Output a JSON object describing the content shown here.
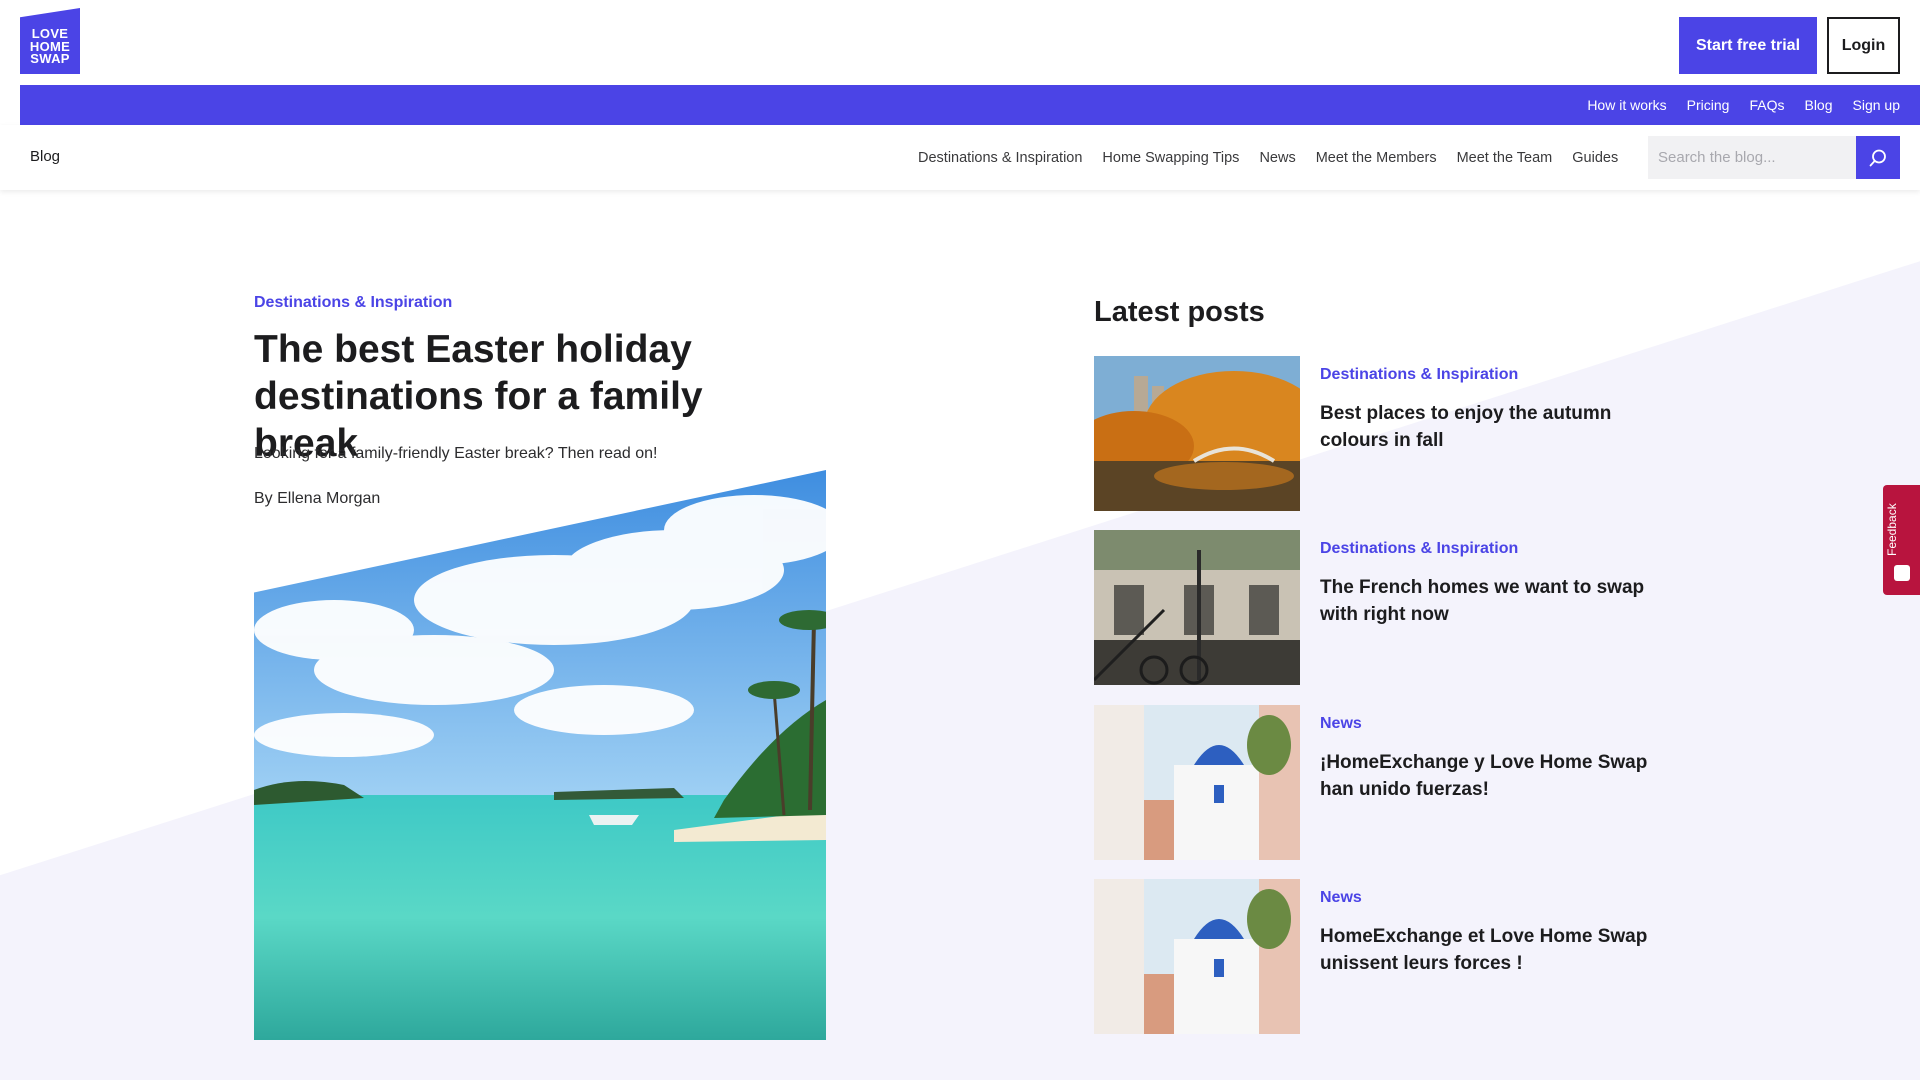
{
  "header": {
    "logo_lines": [
      "LOVE",
      "HOME",
      "SWAP"
    ],
    "trial_label": "Start free trial",
    "login_label": "Login"
  },
  "top_nav": [
    {
      "label": "How it works"
    },
    {
      "label": "Pricing"
    },
    {
      "label": "FAQs"
    },
    {
      "label": "Blog"
    },
    {
      "label": "Sign up"
    }
  ],
  "blog_nav": {
    "home_label": "Blog",
    "items": [
      {
        "label": "Destinations & Inspiration"
      },
      {
        "label": "Home Swapping Tips"
      },
      {
        "label": "News"
      },
      {
        "label": "Meet the Members"
      },
      {
        "label": "Meet the Team"
      },
      {
        "label": "Guides"
      }
    ],
    "search_placeholder": "Search the blog..."
  },
  "article": {
    "category": "Destinations & Inspiration",
    "title": "The best Easter holiday destinations for a family break",
    "excerpt": "Looking for a family-friendly Easter break? Then read on!",
    "author": "By Ellena Morgan"
  },
  "latest": {
    "heading": "Latest posts",
    "posts": [
      {
        "category": "Destinations & Inspiration",
        "title": "Best places to enjoy the autumn colours in fall"
      },
      {
        "category": "Destinations & Inspiration",
        "title": "The French homes we want to swap with right now"
      },
      {
        "category": "News",
        "title": "¡HomeExchange y Love Home Swap han unido fuerzas!"
      },
      {
        "category": "News",
        "title": "HomeExchange et Love Home Swap unissent leurs forces !"
      }
    ]
  },
  "feedback_label": "Feedback",
  "colors": {
    "brand": "#4b44e6",
    "feedback": "#b8143e",
    "background_tint": "#f4f3fc"
  }
}
